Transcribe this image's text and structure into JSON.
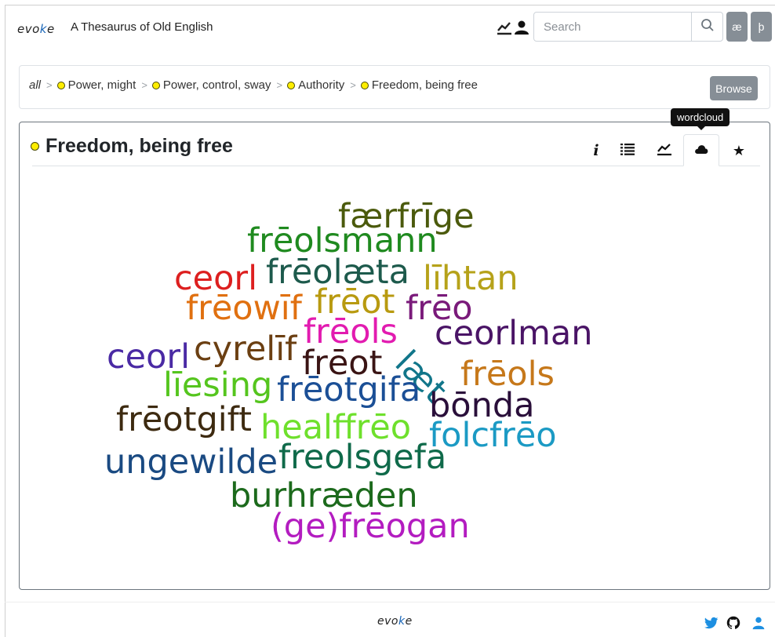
{
  "app": {
    "brand_left": "evo",
    "brand_k": "k",
    "brand_right": "e",
    "title": "A Thesaurus of Old English"
  },
  "header": {
    "search_placeholder": "Search",
    "char_buttons": [
      "æ",
      "þ"
    ],
    "icons": [
      "trend-chart-icon",
      "user-icon",
      "search-icon"
    ]
  },
  "breadcrumb": {
    "root": "all",
    "separator": ">",
    "items": [
      "Power, might",
      "Power, control, sway",
      "Authority",
      "Freedom, being free"
    ],
    "browse_label": "Browse"
  },
  "panel": {
    "title": "Freedom, being free",
    "tooltip": "wordcloud",
    "tabs": [
      {
        "icon": "info-icon",
        "glyph": "𝑖"
      },
      {
        "icon": "list-icon",
        "glyph": "≣"
      },
      {
        "icon": "chart-icon",
        "glyph": ""
      },
      {
        "icon": "cloud-icon",
        "glyph": "",
        "active": true
      },
      {
        "icon": "star-icon",
        "glyph": "★"
      }
    ]
  },
  "wordcloud": [
    {
      "text": "færfrīge",
      "color": "#4b5a0c"
    },
    {
      "text": "frēolsmann",
      "color": "#1f8a1f"
    },
    {
      "text": "ceorl",
      "color": "#dd1f1f"
    },
    {
      "text": "frēolæta",
      "color": "#1d5a4c"
    },
    {
      "text": "līhtan",
      "color": "#b6a21a"
    },
    {
      "text": "frēowīf",
      "color": "#e07010"
    },
    {
      "text": "frēot",
      "color": "#b89a10"
    },
    {
      "text": "frēo",
      "color": "#7a1a7a"
    },
    {
      "text": "frēols",
      "color": "#e21bb0"
    },
    {
      "text": "ceorlman",
      "color": "#4a1466"
    },
    {
      "text": "ceorl",
      "color": "#4a2aa4"
    },
    {
      "text": "cyrelīf",
      "color": "#6b3f12"
    },
    {
      "text": "frēot",
      "color": "#3a1414"
    },
    {
      "text": "læt",
      "color": "#11768a"
    },
    {
      "text": "frēols",
      "color": "#c6781a"
    },
    {
      "text": "līesing",
      "color": "#55c51e"
    },
    {
      "text": "frēotgifa",
      "color": "#1b4f96"
    },
    {
      "text": "bōnda",
      "color": "#2a0f3a"
    },
    {
      "text": "frēotgift",
      "color": "#3d2a10"
    },
    {
      "text": "healffrēo",
      "color": "#6ee02c"
    },
    {
      "text": "folcfrēo",
      "color": "#1b9ac4"
    },
    {
      "text": "ungewilde",
      "color": "#1a4a82"
    },
    {
      "text": "freolsgefa",
      "color": "#0f6a4a"
    },
    {
      "text": "burhræden",
      "color": "#1c6a1c"
    },
    {
      "text": "(ge)frēogan",
      "color": "#b31cc0"
    }
  ],
  "footer": {
    "brand_left": "evo",
    "brand_k": "k",
    "brand_right": "e",
    "social_icons": [
      "twitter-icon",
      "github-icon",
      "user-icon"
    ]
  },
  "colors": {
    "node_dot": "#ffee00",
    "button_grey": "#868e96",
    "link_blue": "#1d8fe1"
  }
}
